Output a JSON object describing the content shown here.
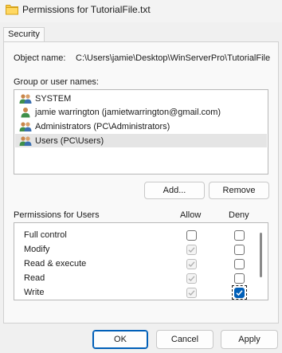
{
  "window": {
    "title": "Permissions for TutorialFile.txt",
    "icon": "folder-icon"
  },
  "tabs": [
    {
      "label": "Security",
      "active": true
    }
  ],
  "object": {
    "label": "Object name:",
    "value": "C:\\Users\\jamie\\Desktop\\WinServerPro\\TutorialFile"
  },
  "groups": {
    "label": "Group or user names:",
    "items": [
      {
        "label": "SYSTEM",
        "icon": "user-group-icon",
        "selected": false
      },
      {
        "label": "jamie warrington (jamietwarrington@gmail.com)",
        "icon": "user-icon",
        "selected": false
      },
      {
        "label": "Administrators (PC\\Administrators)",
        "icon": "user-group-icon",
        "selected": false
      },
      {
        "label": "Users (PC\\Users)",
        "icon": "user-group-icon",
        "selected": true
      }
    ],
    "add_label": "Add...",
    "remove_label": "Remove"
  },
  "permissions": {
    "header_label": "Permissions for Users",
    "allow_label": "Allow",
    "deny_label": "Deny",
    "rows": [
      {
        "name": "Full control",
        "allow": "unchecked",
        "deny": "unchecked"
      },
      {
        "name": "Modify",
        "allow": "inherited-checked",
        "deny": "unchecked"
      },
      {
        "name": "Read & execute",
        "allow": "inherited-checked",
        "deny": "unchecked"
      },
      {
        "name": "Read",
        "allow": "inherited-checked",
        "deny": "unchecked"
      },
      {
        "name": "Write",
        "allow": "inherited-checked",
        "deny": "checked"
      }
    ]
  },
  "footer": {
    "ok_label": "OK",
    "cancel_label": "Cancel",
    "apply_label": "Apply"
  },
  "colors": {
    "accent": "#005fb8",
    "window_bg": "#f0f0f0",
    "panel_bg": "#f9f9f9"
  }
}
